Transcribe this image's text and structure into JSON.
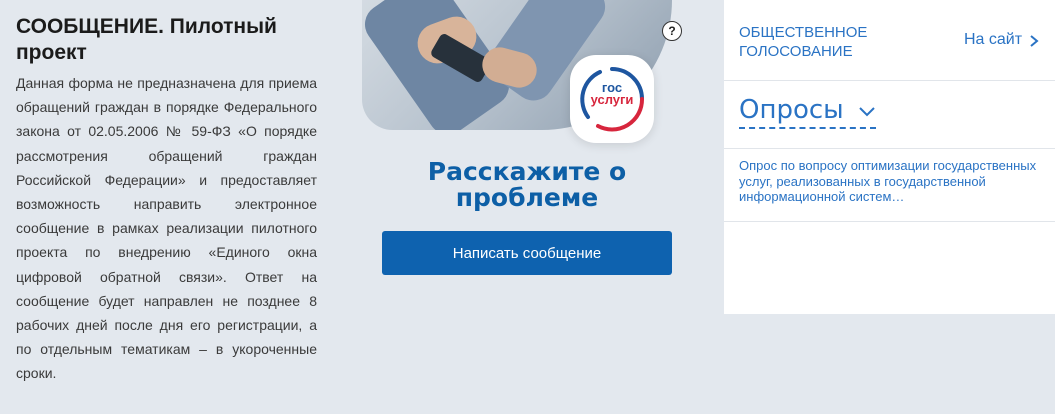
{
  "left": {
    "title": "СООБЩЕНИЕ. Пилотный проект",
    "description": "Данная форма не предназначена для приема обращений граждан в порядке Федерального закона от 02.05.2006 № 59-ФЗ «О порядке рассмотрения обращений граждан Российской Федерации» и предоставляет возможность направить электронное сообщение в рамках реализации пилотного проекта по внедрению «Единого окна цифровой обратной связи». Ответ на сообщение будет направлен не позднее 8 рабочих дней после дня его регистрации, а по отдельным тематикам – в укороченные сроки."
  },
  "middle": {
    "help_symbol": "?",
    "logo": {
      "line1": "гос",
      "line2": "услуги"
    },
    "cta_title": "Расскажите о проблеме",
    "write_button": "Написать сообщение"
  },
  "right": {
    "vote_title": "ОБЩЕСТВЕННОЕ ГОЛОСОВАНИЕ",
    "site_link": "На сайт",
    "polls_title": "Опросы",
    "poll_item": "Опрос по вопросу оптимизации государственных услуг, реализованных в государственной информационной систем…"
  },
  "colors": {
    "background": "#e3e8ee",
    "accent_blue": "#0e62af",
    "link_blue": "#2a73c4",
    "logo_red": "#d7263d"
  },
  "icons": [
    "help-icon",
    "chevron-right-icon",
    "chevron-down-icon",
    "gosuslugi-logo"
  ]
}
